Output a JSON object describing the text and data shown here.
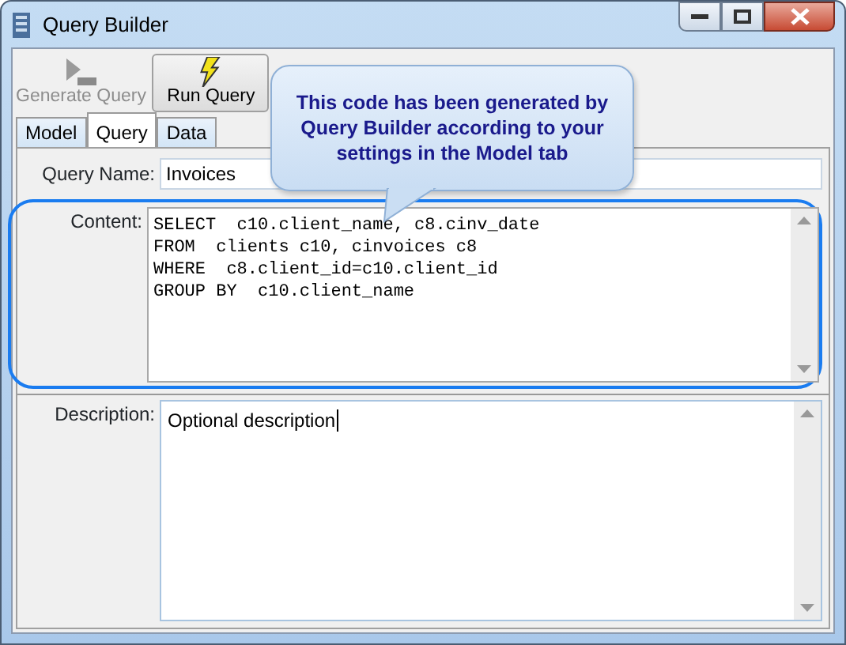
{
  "window": {
    "title": "Query Builder"
  },
  "toolbar": [
    {
      "label": "Generate Query",
      "kind": "sql",
      "disabled": true
    },
    {
      "label": "Run Query",
      "kind": "run",
      "disabled": false
    }
  ],
  "tabs": [
    {
      "label": "Model",
      "selected": false
    },
    {
      "label": "Query",
      "selected": true
    },
    {
      "label": "Data",
      "selected": false
    }
  ],
  "form": {
    "name_label": "Query Name:",
    "name_value": "Invoices",
    "content_label": "Content:",
    "content_lines": [
      "SELECT  c10.client_name, c8.cinv_date",
      "FROM  clients c10, cinvoices c8",
      "WHERE  c8.client_id=c10.client_id",
      "GROUP BY  c10.client_name"
    ],
    "description_label": "Description:",
    "description_value": "Optional description"
  },
  "callout": {
    "text": "This code has been generated by Query Builder according to your settings in the Model tab"
  }
}
